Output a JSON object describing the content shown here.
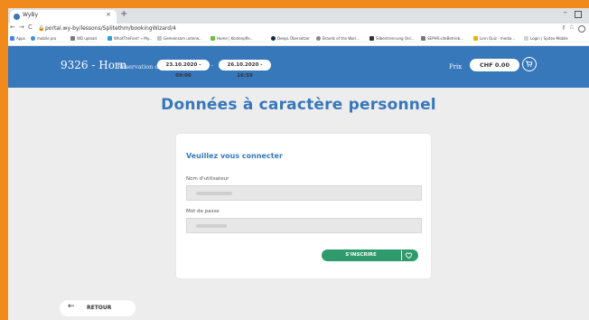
{
  "browser": {
    "tab_title": "WyBy",
    "tab_close": "×",
    "new_tab": "+",
    "url": "portal.wy-by/lessons/Splitethm/bookingWizard/4",
    "nav": {
      "back": "←",
      "forward": "→",
      "reload": "C"
    },
    "bookmarks": [
      "Apps",
      "mobile.pro",
      "WD upload",
      "WhatTheFont! » My...",
      "Gemeinsam unterw...",
      "Home | Kostenpfle...",
      "DeepL Übersetzer",
      "Brands of the Worl...",
      "Silbentrennung Onl...",
      "SEPHR.siteBetrieb...",
      "Lern Quiz - media...",
      "Login | Spitex-Mobile"
    ]
  },
  "header": {
    "site_name": "9326 - Horn",
    "reservation_label": "Réservation du",
    "date_start": "23.10.2020 - 09:00",
    "date_separator": "-",
    "date_end": "26.10.2020 - 16:59",
    "price_label": "Prix",
    "price_value": "CHF 0.00",
    "cart_icon": "cart-icon",
    "color": "#3778bb"
  },
  "page": {
    "title": "Données à caractère personnel"
  },
  "login": {
    "heading": "Veuillez vous connecter",
    "username_label": "Nom d'utilisateur",
    "password_label": "Mot de passe",
    "signup_label": "S'INSCRIRE",
    "signup_color": "#2f9a6b"
  },
  "footer": {
    "back_arrow": "←",
    "back_label": "RETOUR"
  }
}
